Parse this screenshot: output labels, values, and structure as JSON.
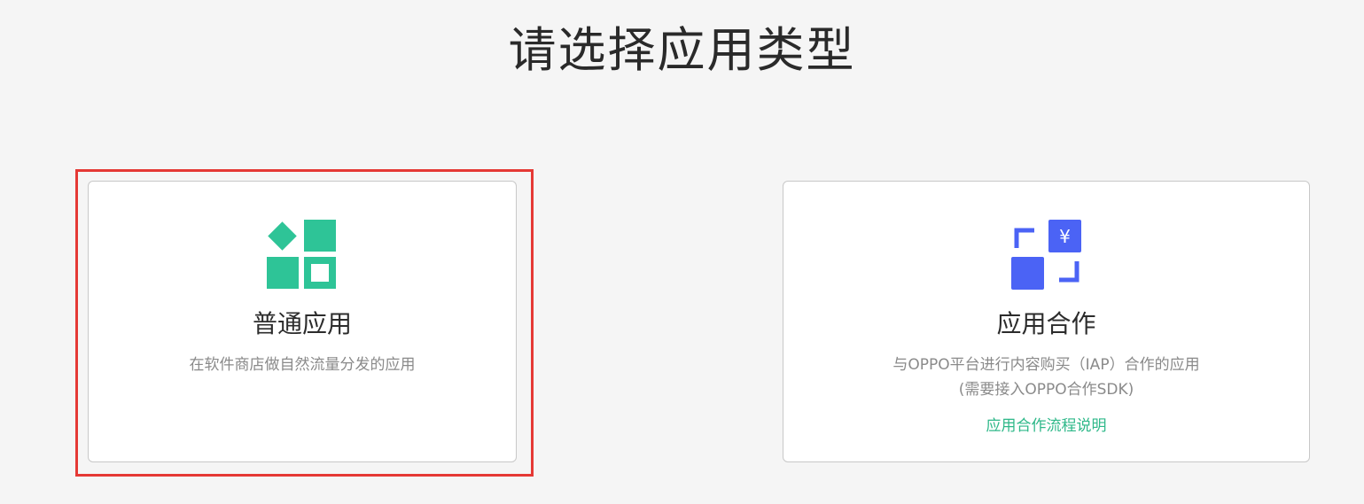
{
  "page": {
    "title": "请选择应用类型"
  },
  "cards": [
    {
      "id": "normal",
      "title": "普通应用",
      "description": "在软件商店做自然流量分发的应用",
      "icon": "app-grid-icon",
      "icon_color": "#2ec497",
      "selected": true
    },
    {
      "id": "cooperation",
      "title": "应用合作",
      "description_line1": "与OPPO平台进行内容购买（IAP）合作的应用",
      "description_line2": "(需要接入OPPO合作SDK)",
      "link": "应用合作流程说明",
      "icon": "payment-frame-icon",
      "icon_color": "#4b63f5",
      "currency_symbol": "¥",
      "selected": false
    }
  ],
  "colors": {
    "background": "#f5f5f5",
    "selection_outline": "#e53935",
    "link": "#2eb889"
  }
}
